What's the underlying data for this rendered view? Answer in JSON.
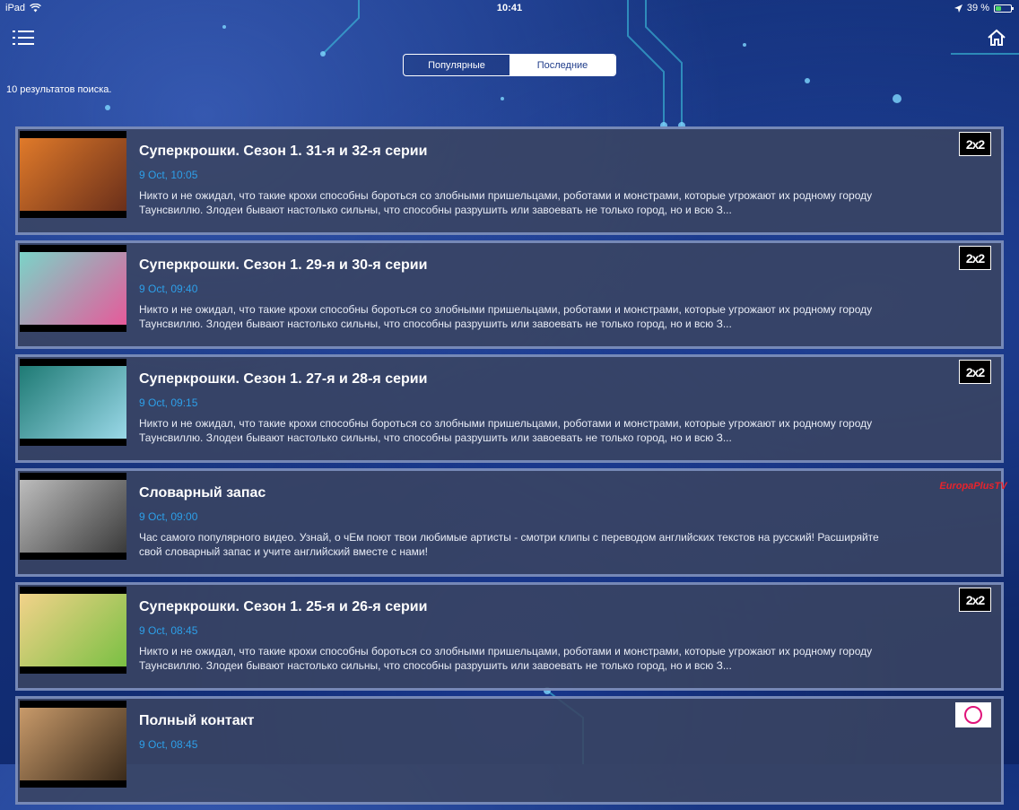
{
  "status_bar": {
    "device": "iPad",
    "time": "10:41",
    "battery": "39 %",
    "battery_level": 0.39
  },
  "header": {
    "menu_icon": "list-menu-icon",
    "home_icon": "home-icon",
    "tabs": [
      {
        "label": "Популярные",
        "active": false
      },
      {
        "label": "Последние",
        "active": true
      }
    ]
  },
  "results": {
    "count_text": "10 результатов поиска."
  },
  "items": [
    {
      "title": "Суперкрошки. Сезон 1. 31-я и 32-я серии",
      "time": "9 Oct, 10:05",
      "description": "Никто и не ожидал, что такие крохи способны бороться со злобными пришельцами, роботами и монстрами, которые угрожают их родному городу Таунсвиллю. Злодеи бывают настолько сильны, что способны разрушить или завоевать не только город, но и всю З...",
      "channel": "2x2",
      "thumb_colors": [
        "#e07a2a",
        "#6a2f1a"
      ]
    },
    {
      "title": "Суперкрошки. Сезон 1. 29-я и 30-я серии",
      "time": "9 Oct, 09:40",
      "description": "Никто и не ожидал, что такие крохи способны бороться со злобными пришельцами, роботами и монстрами, которые угрожают их родному городу Таунсвиллю. Злодеи бывают настолько сильны, что способны разрушить или завоевать не только город, но и всю З...",
      "channel": "2x2",
      "thumb_colors": [
        "#7ad4c8",
        "#e65a9a"
      ]
    },
    {
      "title": "Суперкрошки. Сезон 1. 27-я и 28-я серии",
      "time": "9 Oct, 09:15",
      "description": "Никто и не ожидал, что такие крохи способны бороться со злобными пришельцами, роботами и монстрами, которые угрожают их родному городу Таунсвиллю. Злодеи бывают настолько сильны, что способны разрушить или завоевать не только город, но и всю З...",
      "channel": "2x2",
      "thumb_colors": [
        "#1e7a74",
        "#9ad8e8"
      ]
    },
    {
      "title": "Словарный запас",
      "time": "9 Oct, 09:00",
      "description": "Час самого популярного видео. Узнай, о чЕм поют твои любимые артисты - смотри клипы с переводом английских текстов на русский! Расширяйте свой словарный запас и учите английский вместе с нами!",
      "channel": "Europa Plus TV",
      "thumb_colors": [
        "#bdbdbd",
        "#3a3a3a"
      ]
    },
    {
      "title": "Суперкрошки. Сезон 1. 25-я и 26-я серии",
      "time": "9 Oct, 08:45",
      "description": "Никто и не ожидал, что такие крохи способны бороться со злобными пришельцами, роботами и монстрами, которые угрожают их родному городу Таунсвиллю. Злодеи бывают настолько сильны, что способны разрушить или завоевать не только город, но и всю З...",
      "channel": "2x2",
      "thumb_colors": [
        "#f2d28a",
        "#7ac043"
      ]
    },
    {
      "title": "Полный контакт",
      "time": "9 Oct, 08:45",
      "description": "",
      "channel": "round-logo",
      "thumb_colors": [
        "#c89a6a",
        "#3a2a1a"
      ]
    }
  ],
  "channels": {
    "two_by_two": "2x2",
    "europa": "EuropaPlusTV"
  }
}
